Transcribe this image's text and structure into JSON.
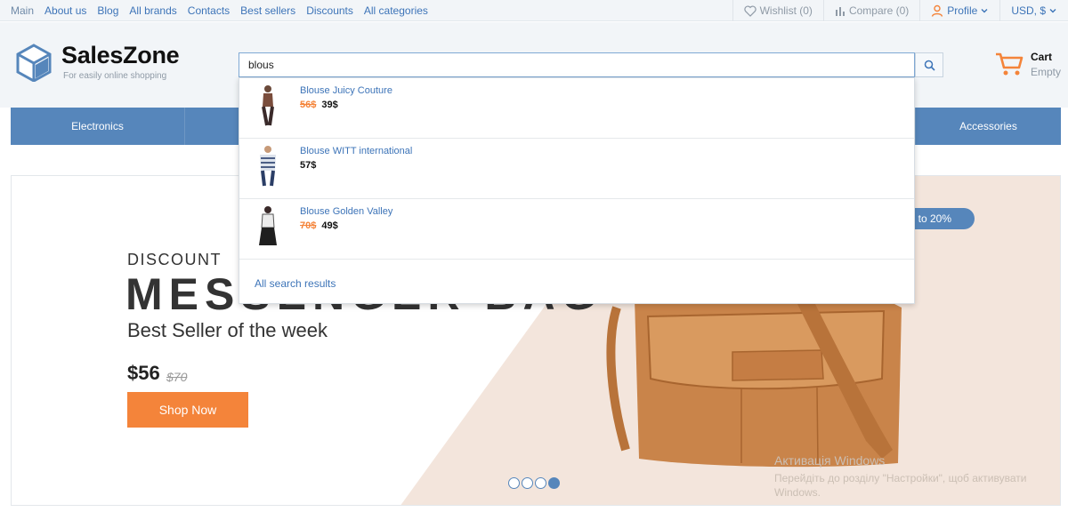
{
  "topnav": [
    "Main",
    "About us",
    "Blog",
    "All brands",
    "Contacts",
    "Best sellers",
    "Discounts",
    "All categories"
  ],
  "topright": {
    "wishlist": "Wishlist (0)",
    "compare": "Compare (0)",
    "profile": "Profile",
    "currency": "USD, $"
  },
  "logo": {
    "title": "SalesZone",
    "subtitle": "For easily online shopping"
  },
  "search": {
    "value": "blous"
  },
  "cart": {
    "title": "Cart",
    "status": "Empty"
  },
  "categories": {
    "first": "Electronics",
    "last": "Accessories"
  },
  "suggestions": [
    {
      "name": "Blouse Juicy Couture",
      "old_price": "56$",
      "price": "39$"
    },
    {
      "name": "Blouse WITT international",
      "old_price": "",
      "price": "57$"
    },
    {
      "name": "Blouse Golden Valley",
      "old_price": "70$",
      "price": "49$"
    }
  ],
  "all_results": "All search results",
  "hero": {
    "discount": "DISCOUNT",
    "title": "MESSENGER BAG",
    "subtitle": "Best Seller of the week",
    "price": "$56",
    "old_price": "$70",
    "button": "Shop Now",
    "promo": "to 20%",
    "slides": 4,
    "active_slide": 4
  },
  "watermark": {
    "title": "Активація Windows",
    "text": "Перейдіть до розділу \"Настройки\", щоб активувати Windows."
  },
  "colors": {
    "accent_orange": "#f4843a",
    "brand_blue": "#5686bb",
    "link_blue": "#3d74b8"
  }
}
